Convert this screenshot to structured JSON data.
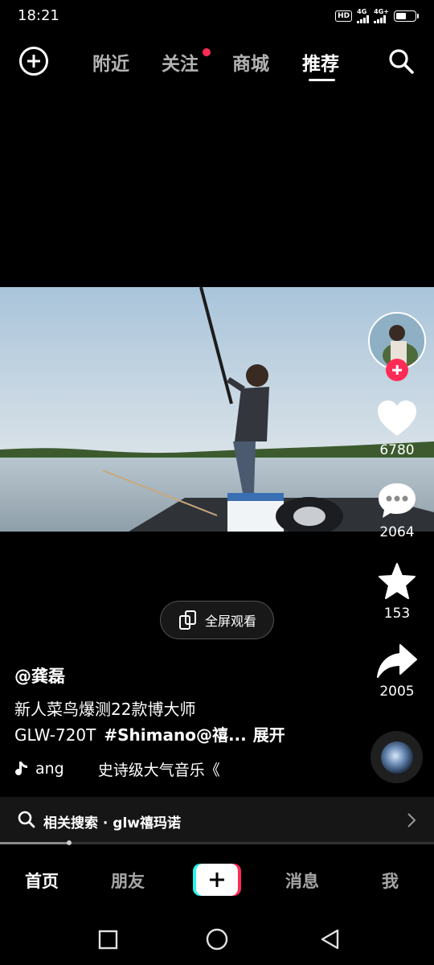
{
  "status_bar": {
    "time": "18:21",
    "hd_label": "HD",
    "network_1": "4G",
    "network_2": "4G+",
    "battery_level": 0.55
  },
  "top_nav": {
    "tabs": [
      {
        "label": "附近",
        "active": false
      },
      {
        "label": "关注",
        "active": false,
        "has_notification_dot": true
      },
      {
        "label": "商城",
        "active": false
      },
      {
        "label": "推荐",
        "active": true
      }
    ],
    "notification_color": "#fe2c55"
  },
  "sidebar": {
    "like_count": "6780",
    "comment_count": "2064",
    "favorite_count": "153",
    "share_count": "2005"
  },
  "fullscreen_button": {
    "label": "全屏观看"
  },
  "post": {
    "author": "@龚磊",
    "caption_line1": "新人菜鸟爆测22款博大师",
    "caption_line2_text": "GLW-720T",
    "caption_hashtag": "#Shimano@禧...",
    "expand_label": "展开",
    "music_part1": "ang",
    "music_part2": "史诗级大气音乐《"
  },
  "related_search": {
    "text": "相关搜索 · glw禧玛诺"
  },
  "progress": {
    "fraction": 0.16
  },
  "bottom_nav": {
    "items": [
      {
        "label": "首页",
        "active": true
      },
      {
        "label": "朋友",
        "active": false
      },
      {
        "label": "消息",
        "active": false
      },
      {
        "label": "我",
        "active": false
      }
    ]
  },
  "colors": {
    "accent_red": "#fe2c55",
    "accent_cyan": "#25f4ee",
    "background": "#000000"
  }
}
